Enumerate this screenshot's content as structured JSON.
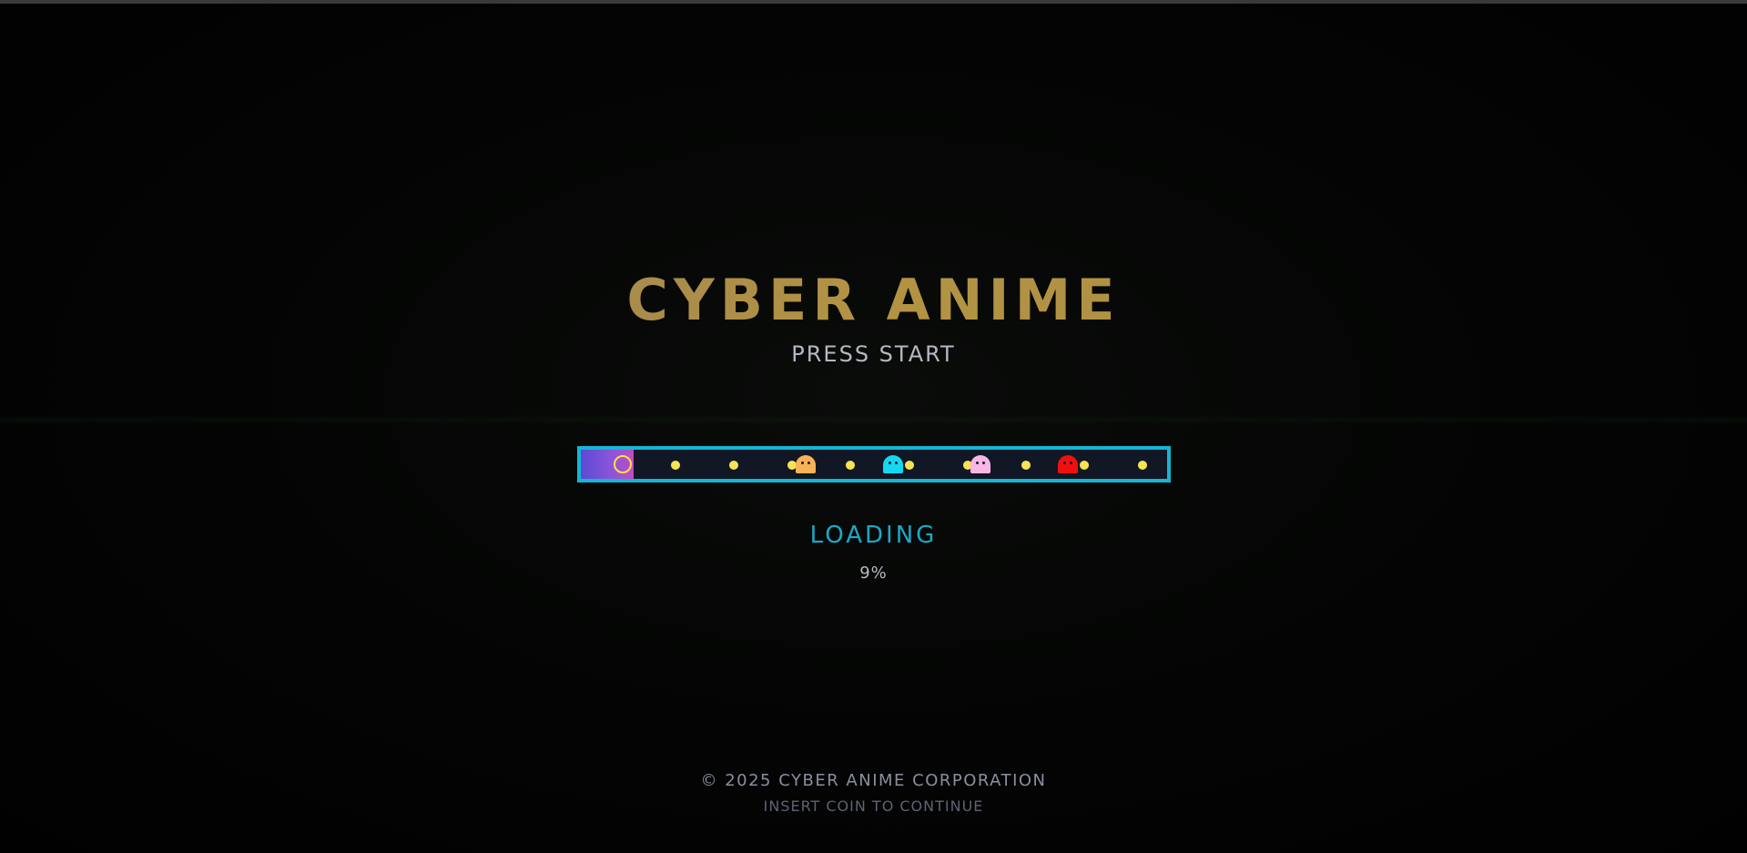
{
  "title": "CYBER ANIME",
  "subtitle": "PRESS START",
  "loading": {
    "label": "LOADING",
    "percent_text": "9%",
    "progress_fraction": 0.09
  },
  "track": {
    "pacman_color": "#f6e34a",
    "dot_color": "#f7e352",
    "frame_color": "#14b6d3",
    "ghosts": [
      {
        "name": "orange-ghost-icon",
        "color": "#f8b356"
      },
      {
        "name": "cyan-ghost-icon",
        "color": "#14d8ef"
      },
      {
        "name": "pink-ghost-icon",
        "color": "#f8b6e6"
      },
      {
        "name": "red-ghost-icon",
        "color": "#f01010"
      }
    ]
  },
  "footer": {
    "copyright": "© 2025 CYBER ANIME CORPORATION",
    "insert_coin": "INSERT COIN TO CONTINUE"
  }
}
